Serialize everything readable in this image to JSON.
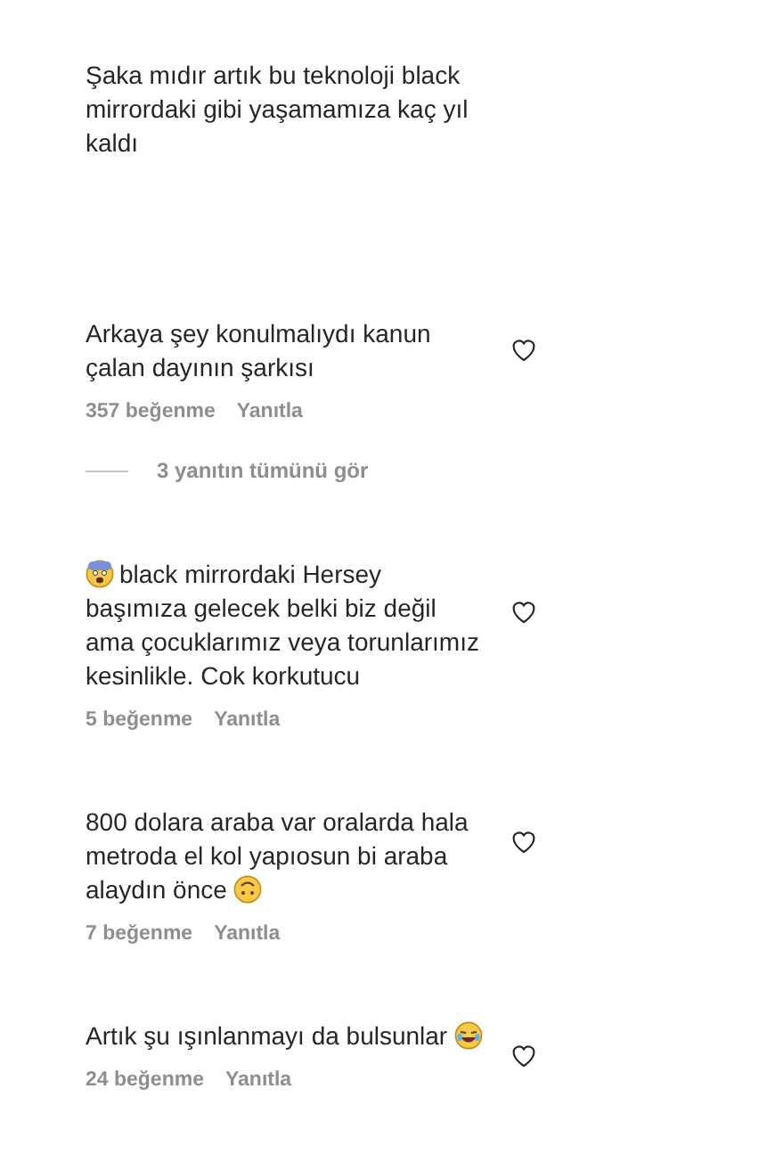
{
  "caption": {
    "text": "Şaka mıdır artık bu teknoloji black mirrordaki gibi yaşamamıza kaç yıl kaldı"
  },
  "comments": [
    {
      "text": "Arkaya şey konulmalıydı kanun çalan dayının şarkısı",
      "likes": "357 beğenme",
      "reply": "Yanıtla",
      "liked": false,
      "view_replies": "3 yanıtın tümünü gör"
    },
    {
      "emoji_start": {
        "kind": "fearful"
      },
      "text": "black mirrordaki Hersey başımıza gelecek belki biz değil ama çocuklarımız veya torunlarımız kesinlikle. Cok korkutucu",
      "likes": "5 beğenme",
      "reply": "Yanıtla",
      "liked": false
    },
    {
      "text": "800 dolara araba var oralarda hala metroda el kol yapıosun bi araba alaydın önce",
      "emoji_end": {
        "kind": "upside-down"
      },
      "likes": "7 beğenme",
      "reply": "Yanıtla",
      "liked": false
    },
    {
      "text": "Artık şu ışınlanmayı da bulsunlar",
      "emoji_end": {
        "kind": "laughing"
      },
      "likes": "24 beğenme",
      "reply": "Yanıtla",
      "liked": false
    }
  ]
}
